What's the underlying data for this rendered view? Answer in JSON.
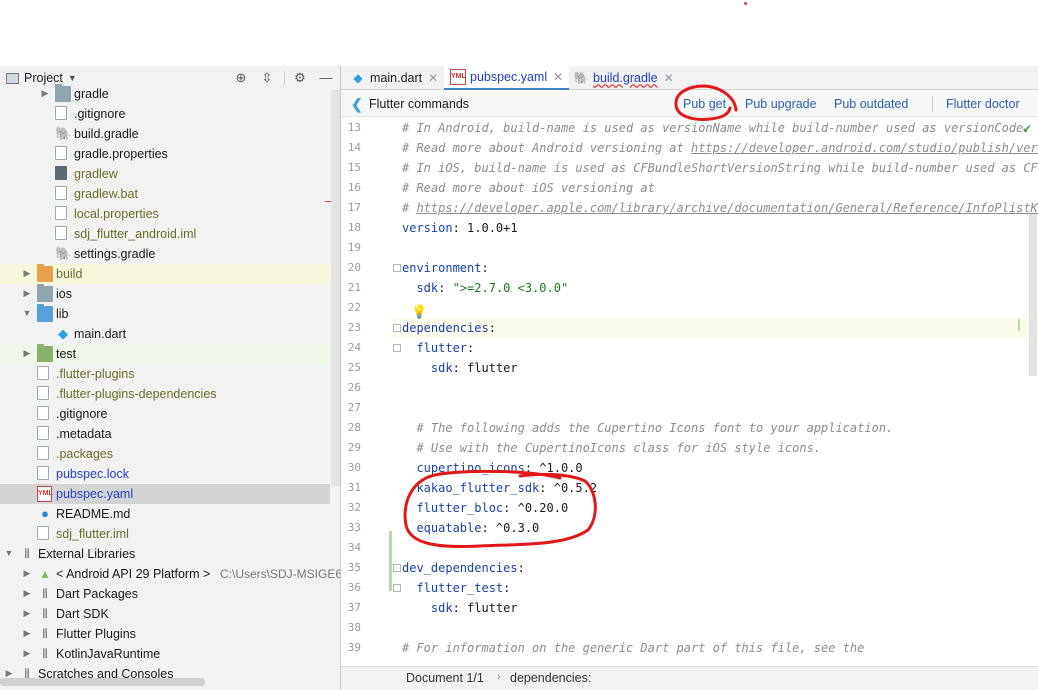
{
  "project_panel": {
    "title": "Project",
    "header_icons": [
      "target-icon",
      "collapse-icon",
      "gear-icon",
      "minimize-icon"
    ],
    "tree": [
      {
        "label": "gradle",
        "icon": "folder",
        "color": "default"
      },
      {
        "label": ".gitignore",
        "icon": "file",
        "color": "default"
      },
      {
        "label": "build.gradle",
        "icon": "gradle",
        "color": "default"
      },
      {
        "label": "gradle.properties",
        "icon": "file-settings",
        "color": "default"
      },
      {
        "label": "gradlew",
        "icon": "file-exec",
        "color": "olive"
      },
      {
        "label": "gradlew.bat",
        "icon": "file",
        "color": "olive"
      },
      {
        "label": "local.properties",
        "icon": "file-settings",
        "color": "olive"
      },
      {
        "label": "sdj_flutter_android.iml",
        "icon": "file-iml",
        "color": "olive"
      },
      {
        "label": "settings.gradle",
        "icon": "gradle",
        "color": "default"
      },
      {
        "label": "build",
        "icon": "folder-orange",
        "color": "olive"
      },
      {
        "label": "ios",
        "icon": "folder",
        "color": "default"
      },
      {
        "label": "lib",
        "icon": "folder-blue",
        "color": "default"
      },
      {
        "label": "main.dart",
        "icon": "dart",
        "color": "default"
      },
      {
        "label": "test",
        "icon": "folder-green",
        "color": "default"
      },
      {
        "label": ".flutter-plugins",
        "icon": "file",
        "color": "olive"
      },
      {
        "label": ".flutter-plugins-dependencies",
        "icon": "file",
        "color": "olive"
      },
      {
        "label": ".gitignore",
        "icon": "file",
        "color": "default"
      },
      {
        "label": ".metadata",
        "icon": "file",
        "color": "default"
      },
      {
        "label": ".packages",
        "icon": "file",
        "color": "olive"
      },
      {
        "label": "pubspec.lock",
        "icon": "file",
        "color": "blue"
      },
      {
        "label": "pubspec.yaml",
        "icon": "yaml",
        "color": "blue"
      },
      {
        "label": "README.md",
        "icon": "md",
        "color": "default"
      },
      {
        "label": "sdj_flutter.iml",
        "icon": "file-iml",
        "color": "olive"
      },
      {
        "label": "External Libraries",
        "icon": "libraries",
        "color": "default"
      },
      {
        "label": "< Android API 29 Platform >",
        "hint": "C:\\Users\\SDJ-MSIGE6",
        "icon": "android",
        "color": "default"
      },
      {
        "label": "Dart Packages",
        "icon": "libraries",
        "color": "default"
      },
      {
        "label": "Dart SDK",
        "icon": "libraries",
        "color": "default"
      },
      {
        "label": "Flutter Plugins",
        "icon": "libraries",
        "color": "default"
      },
      {
        "label": "KotlinJavaRuntime",
        "icon": "libraries",
        "color": "default"
      },
      {
        "label": "Scratches and Consoles",
        "icon": "scratches",
        "color": "default"
      }
    ]
  },
  "tabs": [
    {
      "label": "main.dart",
      "icon": "dart-icon",
      "active": false
    },
    {
      "label": "pubspec.yaml",
      "icon": "yaml-icon",
      "active": true
    },
    {
      "label": "build.gradle",
      "icon": "gradle-icon",
      "active": false
    }
  ],
  "flutter_commands": {
    "title": "Flutter commands",
    "actions": [
      "Pub get",
      "Pub upgrade",
      "Pub outdated",
      "Flutter doctor"
    ]
  },
  "code": {
    "line_numbers": [
      "13",
      "14",
      "15",
      "16",
      "17",
      "18",
      "19",
      "20",
      "21",
      "22",
      "23",
      "24",
      "25",
      "26",
      "27",
      "28",
      "29",
      "30",
      "31",
      "32",
      "33",
      "34",
      "35",
      "36",
      "37",
      "38",
      "39"
    ],
    "lines": [
      {
        "segs": [
          {
            "c": "cm",
            "t": "# In Android, build-name is used as versionName while build-number used as versionCode."
          }
        ]
      },
      {
        "segs": [
          {
            "c": "cm",
            "t": "# Read more about Android versioning at "
          },
          {
            "c": "cm-link",
            "t": "https://developer.android.com/studio/publish/versio"
          }
        ]
      },
      {
        "segs": [
          {
            "c": "cm",
            "t": "# In iOS, build-name is used as CFBundleShortVersionString while build-number used as CFBun"
          }
        ]
      },
      {
        "segs": [
          {
            "c": "cm",
            "t": "# Read more about iOS versioning at"
          }
        ]
      },
      {
        "segs": [
          {
            "c": "cm",
            "t": "# "
          },
          {
            "c": "cm-link",
            "t": "https://developer.apple.com/library/archive/documentation/General/Reference/InfoPlistKeyR"
          }
        ]
      },
      {
        "segs": [
          {
            "c": "key",
            "t": "version"
          },
          {
            "c": "val",
            "t": ": 1.0.0+1"
          }
        ]
      },
      {
        "segs": []
      },
      {
        "segs": [
          {
            "c": "key",
            "t": "environment"
          },
          {
            "c": "val",
            "t": ":"
          }
        ]
      },
      {
        "segs": [
          {
            "c": "val",
            "t": "  "
          },
          {
            "c": "key",
            "t": "sdk"
          },
          {
            "c": "val",
            "t": ": "
          },
          {
            "c": "str",
            "t": "\">=2.7.0 <3.0.0\""
          }
        ]
      },
      {
        "segs": []
      },
      {
        "segs": [
          {
            "c": "key",
            "t": "dependencies"
          },
          {
            "c": "val",
            "t": ":"
          }
        ]
      },
      {
        "segs": [
          {
            "c": "val",
            "t": "  "
          },
          {
            "c": "key",
            "t": "flutter"
          },
          {
            "c": "val",
            "t": ":"
          }
        ]
      },
      {
        "segs": [
          {
            "c": "val",
            "t": "    "
          },
          {
            "c": "key",
            "t": "sdk"
          },
          {
            "c": "val",
            "t": ": flutter"
          }
        ]
      },
      {
        "segs": []
      },
      {
        "segs": []
      },
      {
        "segs": [
          {
            "c": "cm",
            "t": "  # The following adds the Cupertino Icons font to your application."
          }
        ]
      },
      {
        "segs": [
          {
            "c": "cm",
            "t": "  # Use with the CupertinoIcons class for iOS style icons."
          }
        ]
      },
      {
        "segs": [
          {
            "c": "val",
            "t": "  "
          },
          {
            "c": "key",
            "t": "cupertino_icons"
          },
          {
            "c": "val",
            "t": ": ^1.0.0"
          }
        ]
      },
      {
        "segs": [
          {
            "c": "val",
            "t": "  "
          },
          {
            "c": "key",
            "t": "kakao_flutter_sdk"
          },
          {
            "c": "val",
            "t": ": ^0.5.2"
          }
        ]
      },
      {
        "segs": [
          {
            "c": "val",
            "t": "  "
          },
          {
            "c": "key",
            "t": "flutter_bloc"
          },
          {
            "c": "val",
            "t": ": ^0.20.0"
          }
        ]
      },
      {
        "segs": [
          {
            "c": "val",
            "t": "  "
          },
          {
            "c": "key",
            "t": "equatable"
          },
          {
            "c": "val",
            "t": ": ^0.3.0"
          }
        ]
      },
      {
        "segs": []
      },
      {
        "segs": [
          {
            "c": "key",
            "t": "dev_dependencies"
          },
          {
            "c": "val",
            "t": ":"
          }
        ]
      },
      {
        "segs": [
          {
            "c": "val",
            "t": "  "
          },
          {
            "c": "key",
            "t": "flutter_test"
          },
          {
            "c": "val",
            "t": ":"
          }
        ]
      },
      {
        "segs": [
          {
            "c": "val",
            "t": "    "
          },
          {
            "c": "key",
            "t": "sdk"
          },
          {
            "c": "val",
            "t": ": flutter"
          }
        ]
      },
      {
        "segs": []
      },
      {
        "segs": [
          {
            "c": "cm",
            "t": "# For information on the generic Dart part of this file, see the"
          }
        ]
      }
    ]
  },
  "status_bar": {
    "document": "Document 1/1",
    "separator": "›",
    "breadcrumb": "dependencies:"
  },
  "colors": {
    "annotation_red": "#e01818",
    "link_blue": "#2a5fb0",
    "key_blue": "#1a3fa8",
    "string_green": "#1c7a1c",
    "comment_gray": "#8c8c8c"
  }
}
